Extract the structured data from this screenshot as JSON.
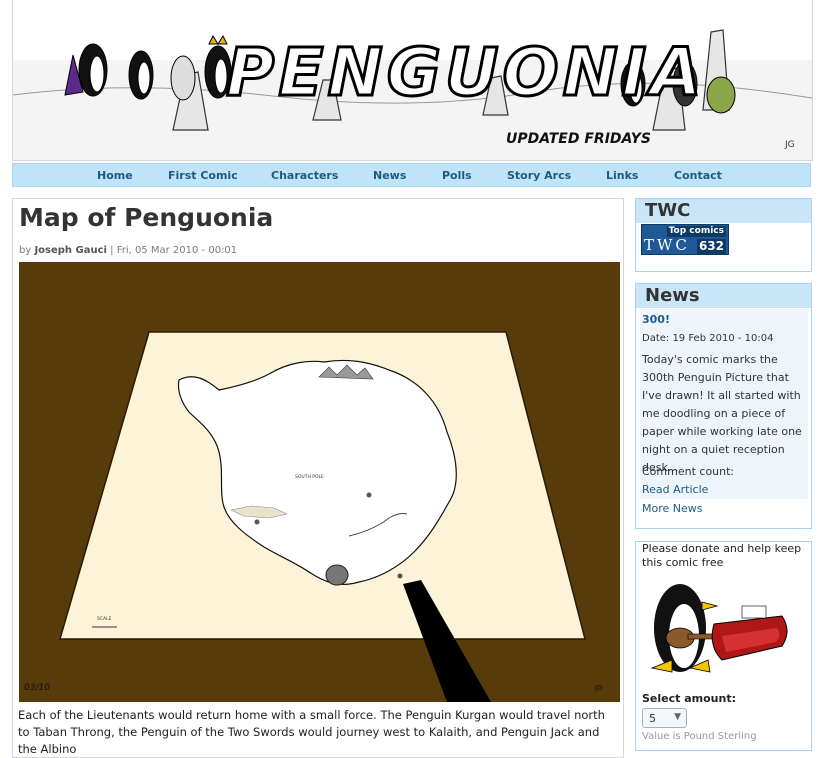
{
  "banner": {
    "logo": "PENGUONIA",
    "tagline": "UPDATED FRIDAYS",
    "signature": "JG"
  },
  "nav": {
    "items": [
      "Home",
      "First Comic",
      "Characters",
      "News",
      "Polls",
      "Story Arcs",
      "Links",
      "Contact"
    ]
  },
  "article": {
    "title": "Map of Penguonia",
    "by_prefix": "by",
    "author": "Joseph Gauci",
    "date": "| Fri, 05 Mar 2010 - 00:01",
    "comic": {
      "date_mark": "03/10",
      "signature": "JG",
      "labels": {
        "south_pole": "SOUTH POLE",
        "scale": "SCALE"
      }
    },
    "body": "Each of the Lieutenants would return home with a small force. The Penguin Kurgan would travel north to Taban Throng, the Penguin of the Two Swords would journey west to Kalaith, and Penguin Jack and the Albino"
  },
  "sidebar": {
    "twc": {
      "heading": "TWC",
      "badge_top": "Top comics",
      "badge_big": "TWC",
      "badge_num": "632"
    },
    "news": {
      "heading": "News",
      "item_title": "300!",
      "item_date": "Date: 19 Feb 2010 - 10:04",
      "item_excerpt": "Today's comic marks the 300th Penguin Picture that I've drawn! It all started with me doodling on a piece of paper while working late one night on a quiet reception desk...",
      "comment_count": "Comment count:",
      "read_article": "Read Article",
      "more_news": "More News"
    },
    "donate": {
      "text": "Please donate and help keep this comic free",
      "select_label": "Select amount:",
      "selected_amount": "5",
      "note": "Value is Pound Sterling"
    }
  }
}
